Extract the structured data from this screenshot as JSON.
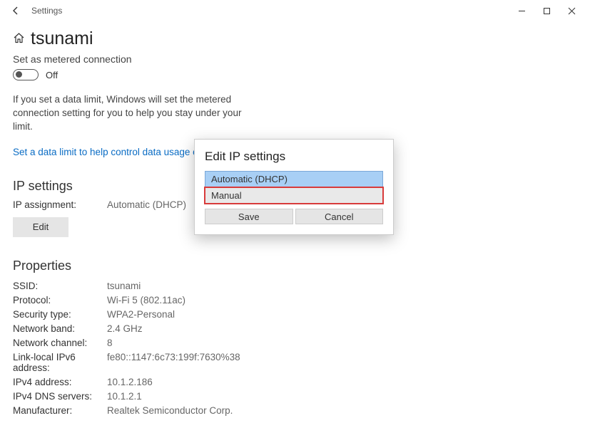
{
  "window": {
    "title": "Settings"
  },
  "network": {
    "name": "tsunami",
    "metered_label": "Set as metered connection",
    "toggle_state": "Off",
    "help_text": "If you set a data limit, Windows will set the metered connection setting for you to help you stay under your limit.",
    "link": "Set a data limit to help control data usage on this network"
  },
  "ip_settings": {
    "heading": "IP settings",
    "assignment_label": "IP assignment:",
    "assignment_value": "Automatic (DHCP)",
    "edit_label": "Edit"
  },
  "properties": {
    "heading": "Properties",
    "rows": [
      {
        "label": "SSID:",
        "value": "tsunami"
      },
      {
        "label": "Protocol:",
        "value": "Wi-Fi 5 (802.11ac)"
      },
      {
        "label": "Security type:",
        "value": "WPA2-Personal"
      },
      {
        "label": "Network band:",
        "value": "2.4 GHz"
      },
      {
        "label": "Network channel:",
        "value": "8"
      },
      {
        "label": "Link-local IPv6 address:",
        "value": "fe80::1147:6c73:199f:7630%38"
      },
      {
        "label": "IPv4 address:",
        "value": "10.1.2.186"
      },
      {
        "label": "IPv4 DNS servers:",
        "value": "10.1.2.1"
      },
      {
        "label": "Manufacturer:",
        "value": "Realtek Semiconductor Corp."
      }
    ]
  },
  "dialog": {
    "title": "Edit IP settings",
    "option_auto": "Automatic (DHCP)",
    "option_manual": "Manual",
    "save": "Save",
    "cancel": "Cancel"
  }
}
